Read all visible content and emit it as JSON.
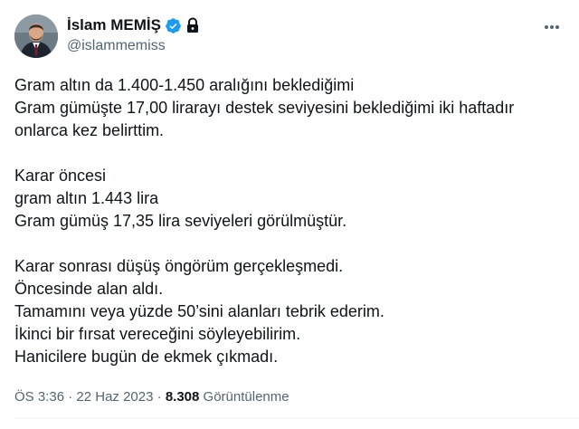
{
  "author": {
    "display_name": "İslam MEMİŞ",
    "handle": "@islammemiss",
    "verified_icon": "verified-badge-icon",
    "protected_icon": "lock-icon",
    "verified_color": "#1d9bf0"
  },
  "menu_icon": "more-horizontal-icon",
  "tweet": {
    "lines": [
      "Gram altın da 1.400-1.450 aralığını beklediğimi",
      "Gram gümüşte 17,00 lirarayı destek seviyesini beklediğimi iki haftadır",
      "onlarca kez belirttim.",
      "",
      "Karar öncesi",
      "gram altın 1.443 lira",
      "Gram gümüş 17,35 lira seviyeleri görülmüştür.",
      "",
      "Karar sonrası düşüş öngörüm gerçekleşmedi.",
      "Öncesinde alan aldı.",
      "Tamamını veya yüzde 50’sini alanları tebrik ederim.",
      "İkinci bir fırsat vereceğini söyleyebilirim.",
      "Hanicilere bugün de ekmek çıkmadı."
    ]
  },
  "meta": {
    "time": "ÖS 3:36",
    "separator": "·",
    "date": "22 Haz 2023",
    "views_count": "8.308",
    "views_label": "Görüntülenme"
  }
}
